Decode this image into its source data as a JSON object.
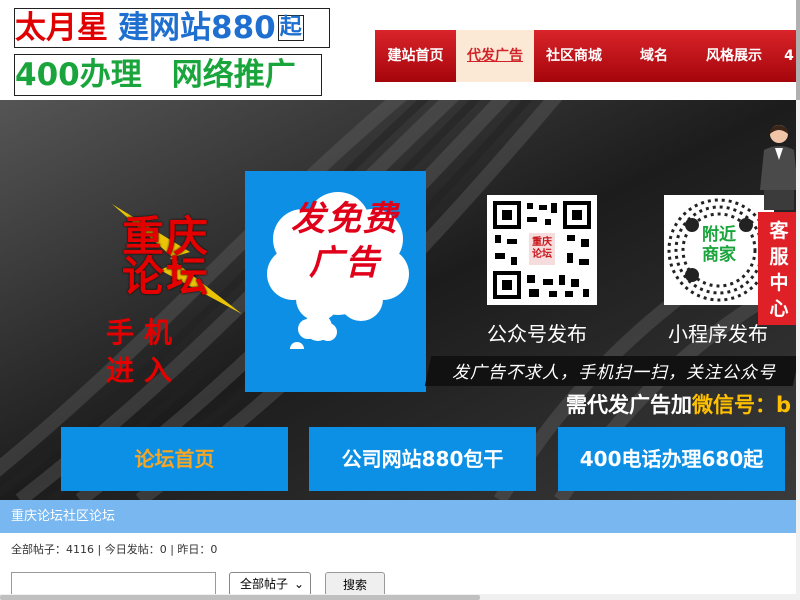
{
  "logo": {
    "brand": "太月星",
    "service": "建网站880",
    "qi": "起",
    "line2_a": "400办理",
    "line2_b": "网络推广"
  },
  "nav": {
    "items": [
      {
        "label": "建站首页"
      },
      {
        "label": "代发广告",
        "active": true
      },
      {
        "label": "社区商城"
      },
      {
        "label": "域名"
      },
      {
        "label": "风格展示"
      },
      {
        "label": "4"
      }
    ]
  },
  "banner": {
    "forum_title_l1": "重庆",
    "forum_title_l2": "论坛",
    "mobile_l1": "手机",
    "mobile_l2": "进入",
    "cloud_text_l1": "发免费",
    "cloud_text_l2": "广告",
    "qr1_center": "重庆论坛",
    "qr1_label": "公众号发布",
    "qr2_center_l1": "附近",
    "qr2_center_l2": "商家",
    "qr2_label": "小程序发布",
    "slogan": "发广告不求人，手机扫一扫，关注公众号",
    "wechat_prefix": "需代发广告加",
    "wechat_highlight": "微信号：b",
    "buttons": [
      {
        "label": "论坛首页"
      },
      {
        "label": "公司网站880包干"
      },
      {
        "label": "400电话办理680起"
      }
    ]
  },
  "kefu": {
    "l1": "客",
    "l2": "服",
    "l3": "中",
    "l4": "心"
  },
  "community": {
    "title": "重庆论坛社区论坛",
    "stats": "全部帖子：4116 | 今日发帖：0 | 昨日：0",
    "search_value": "",
    "select_value": "全部帖子",
    "search_button": "搜索"
  },
  "colors": {
    "brand_red": "#e00000",
    "brand_blue": "#1e6fcf",
    "brand_green": "#19a53b",
    "nav_red": "#c8141a",
    "banner_blue": "#0c90e6",
    "section_blue": "#78b7f0"
  }
}
